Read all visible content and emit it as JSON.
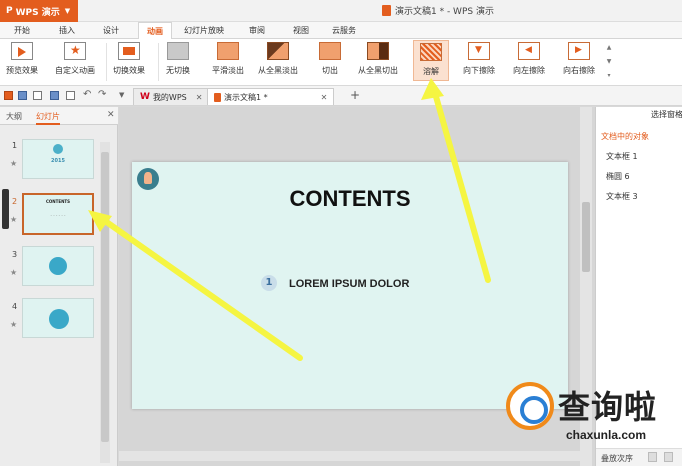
{
  "app": {
    "name": "WPS 演示",
    "logo": "P"
  },
  "window": {
    "title": "演示文稿1 * - WPS 演示"
  },
  "tabs": [
    "开始",
    "插入",
    "设计",
    "动画",
    "幻灯片放映",
    "审阅",
    "视图",
    "云服务"
  ],
  "active_tab": "动画",
  "ribbon": {
    "preview": "预览效果",
    "custom_anim": "自定义动画",
    "switch_effect": "切换效果",
    "items": [
      "无切换",
      "平滑淡出",
      "从全黑淡出",
      "切出",
      "从全黑切出",
      "溶解",
      "向下擦除",
      "向左擦除",
      "向右擦除"
    ]
  },
  "doc_tabs": {
    "mywps": "我的WPS",
    "doc": "演示文稿1 *"
  },
  "left_panel": {
    "tab_outline": "大纲",
    "tab_slides": "幻灯片",
    "slide_numbers": [
      "1",
      "2",
      "3",
      "4"
    ],
    "thumb1_year": "2015",
    "thumb2_title": "CONTENTS"
  },
  "slide": {
    "title": "CONTENTS",
    "item_number": "1",
    "item_text": "LOREM IPSUM DOLOR"
  },
  "right_panel": {
    "header": "选择窗格",
    "subtitle": "文档中的对象",
    "objects": [
      "文本框 1",
      "椭圆 6",
      "文本框 3"
    ],
    "order_label": "叠放次序"
  },
  "watermark": {
    "text": "查询啦",
    "url": "chaxunla.com"
  },
  "colors": {
    "accent": "#e35d1e",
    "slide_bg": "#e0f4f1",
    "arrow": "#f5f542"
  }
}
